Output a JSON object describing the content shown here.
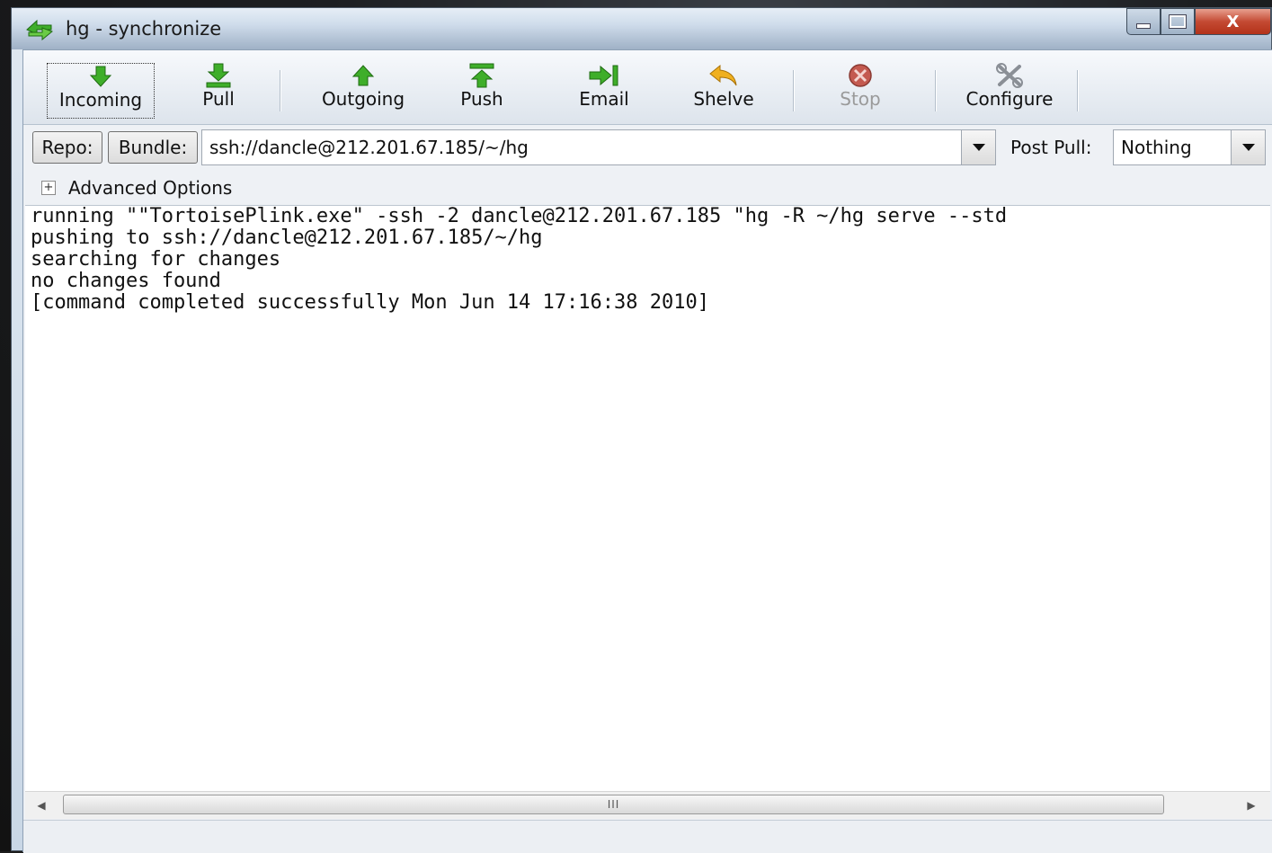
{
  "window": {
    "title": "hg - synchronize",
    "close_glyph": "X"
  },
  "toolbar": {
    "buttons": [
      {
        "label": "Incoming",
        "icon": "arrow-down-icon"
      },
      {
        "label": "Pull",
        "icon": "pull-icon"
      },
      {
        "label": "Outgoing",
        "icon": "arrow-up-icon"
      },
      {
        "label": "Push",
        "icon": "push-icon"
      },
      {
        "label": "Email",
        "icon": "email-icon"
      },
      {
        "label": "Shelve",
        "icon": "shelve-icon"
      },
      {
        "label": "Stop",
        "icon": "stop-icon",
        "disabled": true
      },
      {
        "label": "Configure",
        "icon": "configure-icon"
      }
    ]
  },
  "repo": {
    "repo_label": "Repo:",
    "bundle_label": "Bundle:",
    "url": "ssh://dancle@212.201.67.185/~/hg",
    "post_pull_label": "Post Pull:",
    "post_pull_value": "Nothing"
  },
  "advanced": {
    "expander": "+",
    "label": "Advanced Options"
  },
  "console": {
    "lines": [
      "running \"\"TortoisePlink.exe\" -ssh -2 dancle@212.201.67.185 \"hg -R ~/hg serve --std",
      "pushing to ssh://dancle@212.201.67.185/~/hg",
      "searching for changes",
      "no changes found",
      "[command completed successfully Mon Jun 14 17:16:38 2010]"
    ]
  },
  "scrollbar": {
    "left_arrow": "◀",
    "right_arrow": "▶",
    "grip": "III"
  },
  "colors": {
    "green": "#3fae2a",
    "amber": "#f0b020",
    "stop_red": "#c45a50",
    "gray": "#8a8f96"
  }
}
